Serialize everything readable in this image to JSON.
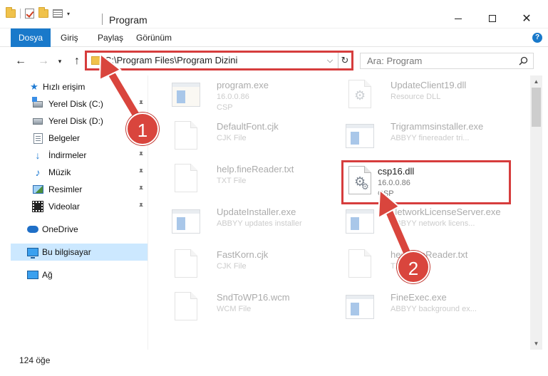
{
  "window": {
    "title": "Program",
    "buttons": {
      "minimize": "minimize",
      "maximize": "maximize",
      "close": "✕"
    }
  },
  "ribbon": {
    "tabs": [
      "Dosya",
      "Giriş",
      "Paylaş",
      "Görünüm"
    ],
    "help": "?"
  },
  "nav": {
    "back": "←",
    "forward": "→",
    "recent": "▾",
    "up": "↑",
    "address": "C:\\Program Files\\Program Dizini",
    "dropdown": "⌵",
    "refresh": "↻",
    "search_placeholder": "Ara: Program"
  },
  "sidebar": {
    "items": [
      {
        "label": "Hızlı erişim",
        "icon": "star-icon",
        "pinned": false
      },
      {
        "label": "Yerel Disk (C:)",
        "icon": "drive-c-icon",
        "pinned": true
      },
      {
        "label": "Yerel Disk (D:)",
        "icon": "drive-d-icon",
        "pinned": true
      },
      {
        "label": "Belgeler",
        "icon": "documents-icon",
        "pinned": true
      },
      {
        "label": "İndirmeler",
        "icon": "downloads-icon",
        "pinned": true
      },
      {
        "label": "Müzik",
        "icon": "music-icon",
        "pinned": true
      },
      {
        "label": "Resimler",
        "icon": "pictures-icon",
        "pinned": true
      },
      {
        "label": "Videolar",
        "icon": "videos-icon",
        "pinned": true
      },
      {
        "label": "OneDrive",
        "icon": "onedrive-icon",
        "pinned": false
      },
      {
        "label": "Bu bilgisayar",
        "icon": "this-pc-icon",
        "pinned": false,
        "selected": true
      },
      {
        "label": "Ağ",
        "icon": "network-icon",
        "pinned": false
      }
    ],
    "pin_glyph": "📌"
  },
  "files": [
    {
      "name": "program.exe",
      "line2": "16.0.0.86",
      "line3": "CSP",
      "icon": "exe-icon",
      "faded": true
    },
    {
      "name": "UpdateClient19.dll",
      "line2": "Resource DLL",
      "line3": "",
      "icon": "dll-icon",
      "faded": true
    },
    {
      "name": "DefaultFont.cjk",
      "line2": "CJK File",
      "line3": "",
      "icon": "file-icon",
      "faded": true
    },
    {
      "name": "Trigrammsinstaller.exe",
      "line2": "ABBYY finereader tri...",
      "line3": "",
      "icon": "app-icon",
      "faded": true
    },
    {
      "name": "help.fineReader.txt",
      "line2": "TXT File",
      "line3": "",
      "icon": "file-icon",
      "faded": true
    },
    {
      "name": "csp16.dll",
      "line2": "16.0.0.86",
      "line3": "CSP",
      "icon": "dll-gear-icon",
      "faded": false,
      "selected": true
    },
    {
      "name": "UpdateInstaller.exe",
      "line2": "ABBYY updates installer",
      "line3": "",
      "icon": "app-icon",
      "faded": true
    },
    {
      "name": "NetworkLicenseServer.exe",
      "line2": "ABBYY network licens...",
      "line3": "",
      "icon": "app-icon",
      "faded": true
    },
    {
      "name": "FastKorn.cjk",
      "line2": "CJK File",
      "line3": "",
      "icon": "file-icon",
      "faded": true
    },
    {
      "name": "help.fineReader.txt",
      "line2": "TXT File",
      "line3": "",
      "icon": "file-icon",
      "faded": true
    },
    {
      "name": "SndToWP16.wcm",
      "line2": "WCM File",
      "line3": "",
      "icon": "file-icon",
      "faded": true
    },
    {
      "name": "FineExec.exe",
      "line2": "ABBYY background ex...",
      "line3": "",
      "icon": "app-icon",
      "faded": true
    }
  ],
  "status": {
    "count": "124 öğe"
  },
  "annotations": {
    "step1": "1",
    "step2": "2"
  },
  "colors": {
    "accent": "#1979ca",
    "highlight": "#d63d3d",
    "selection": "#cce8ff"
  }
}
